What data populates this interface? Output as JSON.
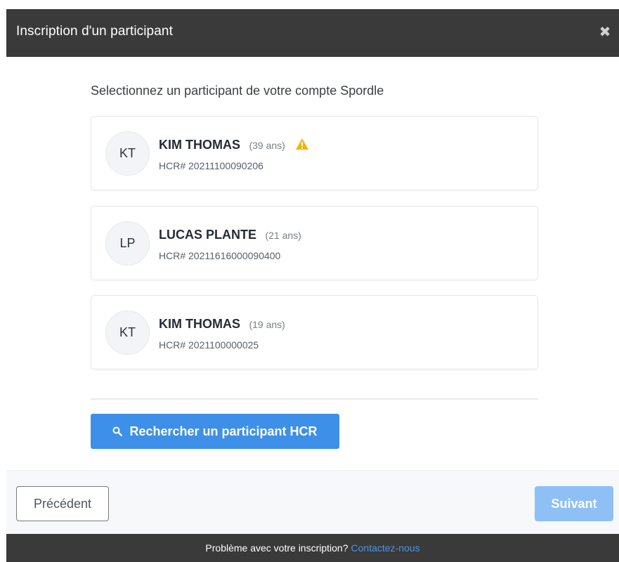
{
  "modal": {
    "title": "Inscription d'un participant",
    "close_glyph": "✖"
  },
  "body": {
    "section_title": "Selectionnez un participant de votre compte Spordle"
  },
  "participants": [
    {
      "initials": "KT",
      "name": "KIM THOMAS",
      "age": "(39 ans)",
      "hcr": "HCR# 20211100090206",
      "warning": true
    },
    {
      "initials": "LP",
      "name": "LUCAS PLANTE",
      "age": "(21 ans)",
      "hcr": "HCR# 20211616000090400",
      "warning": false
    },
    {
      "initials": "KT",
      "name": "KIM THOMAS",
      "age": "(19 ans)",
      "hcr": "HCR# 2021100000025",
      "warning": false
    }
  ],
  "search": {
    "label": "Rechercher un participant HCR",
    "icon": "search-icon"
  },
  "footer": {
    "prev_label": "Précédent",
    "next_label": "Suivant"
  },
  "bottom_bar": {
    "text": "Problème avec votre inscription?",
    "link": "Contactez-nous"
  },
  "colors": {
    "header_bg": "#3a3a3a",
    "primary": "#3d8fe8",
    "primary_disabled": "#8ec0f5",
    "warning": "#f5b400"
  }
}
